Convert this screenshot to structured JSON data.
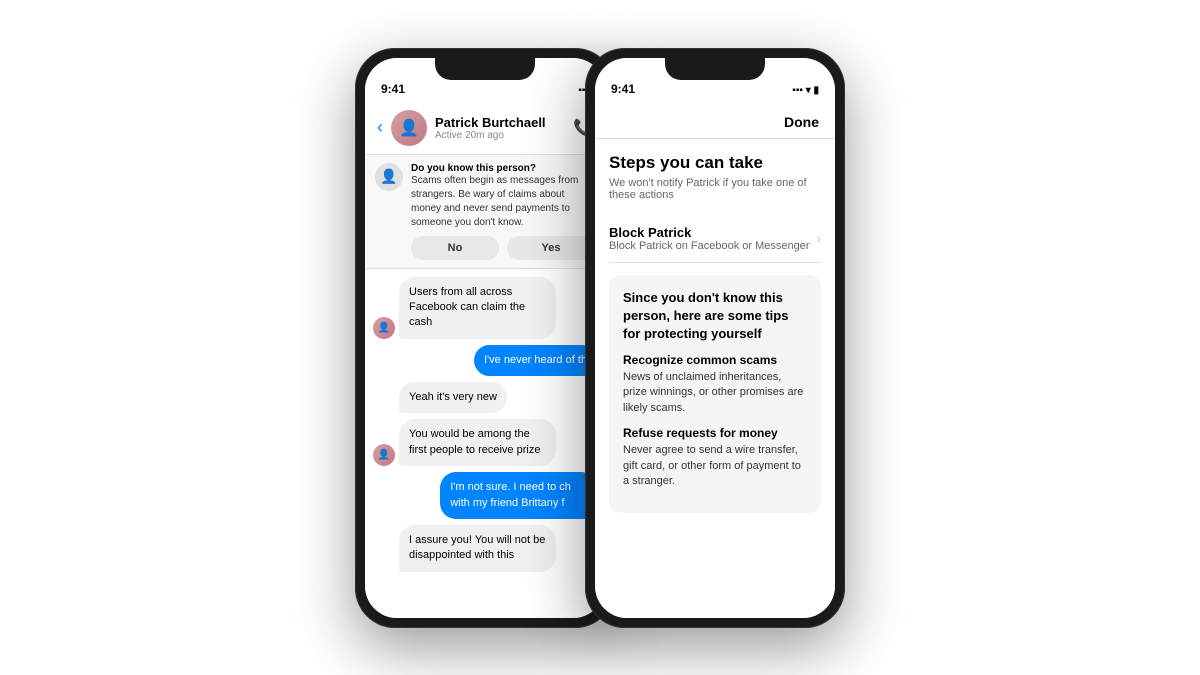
{
  "scene": {
    "bg_color": "#ffffff"
  },
  "phone_left": {
    "status_time": "9:41",
    "contact_name": "Patrick Burtchaell",
    "contact_status": "Active 20m ago",
    "warning_title": "Do you know this person?",
    "warning_body": "Scams often begin as messages from strangers. Be wary of claims about money and never send payments to someone you don't know.",
    "btn_no": "No",
    "btn_yes": "Yes",
    "messages": [
      {
        "type": "received",
        "text": "Users from all across Facebook can claim the cash",
        "has_avatar": true
      },
      {
        "type": "sent",
        "text": "I've never heard of th",
        "has_avatar": false
      },
      {
        "type": "received",
        "text": "Yeah it's very new",
        "has_avatar": false
      },
      {
        "type": "received",
        "text": "You would be among the first people to receive prize",
        "has_avatar": true
      },
      {
        "type": "sent",
        "text": "I'm not sure. I need to ch with my friend Brittany f",
        "has_avatar": false
      },
      {
        "type": "received",
        "text": "I assure you! You will not be disappointed with this",
        "has_avatar": false
      }
    ]
  },
  "phone_right": {
    "status_time": "9:41",
    "done_label": "Done",
    "steps_title": "Steps you can take",
    "steps_subtitle": "We won't notify Patrick if you take one of these actions",
    "block_title": "Block Patrick",
    "block_subtitle": "Block Patrick on Facebook or Messenger",
    "tips_card_title": "Since you don't know this person, here are some tips for protecting yourself",
    "tip1_title": "Recognize common scams",
    "tip1_text": "News of unclaimed inheritances, prize winnings, or other promises are likely scams.",
    "tip2_title": "Refuse requests for money",
    "tip2_text": "Never agree to send a wire transfer, gift card, or other form of payment to a stranger."
  }
}
